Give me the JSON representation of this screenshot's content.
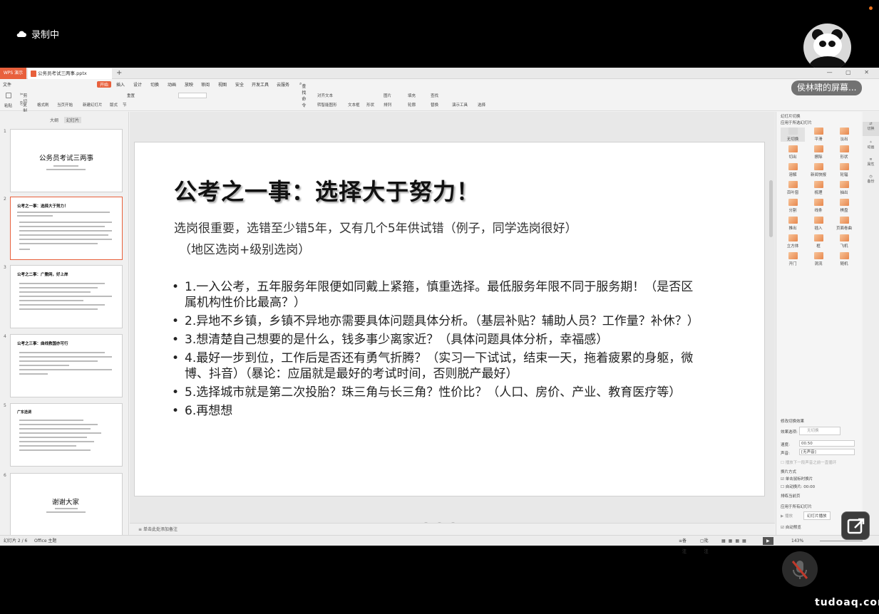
{
  "recording": {
    "label": "录制中"
  },
  "participant": {
    "name": "侯林啸的屏幕..."
  },
  "tabs": {
    "app": "WPS 演示",
    "document": "公务员考试三两事.pptx",
    "new_tab": "+"
  },
  "menu": {
    "file": "文件",
    "items": [
      "开始",
      "插入",
      "设计",
      "切换",
      "动画",
      "放映",
      "审阅",
      "视图",
      "安全",
      "开发工具",
      "云服务"
    ],
    "search": "查找命令"
  },
  "toolbar": {
    "cut": "剪切",
    "copy": "复制",
    "format_painter": "格式刷",
    "paste": "粘贴",
    "play_from": "当页开始",
    "new_slide": "新建幻灯片",
    "layout": "版式",
    "section": "节",
    "reset": "重置",
    "textbox": "文本框",
    "shape": "形状",
    "arrange": "排列",
    "picture": "图片",
    "fill": "填充",
    "outline": "轮廓",
    "find": "查找",
    "replace": "替换",
    "present_tools": "演示工具",
    "select": "选择",
    "align_text": "对齐文本",
    "smartart": "转智能图形"
  },
  "left_panel": {
    "tab_outline": "大纲",
    "tab_slides": "幻灯片",
    "thumbs": [
      {
        "num": "1",
        "title": "公务员考试三两事"
      },
      {
        "num": "2",
        "title": "公考之一事：选择大于努力！"
      },
      {
        "num": "3",
        "title": "公考之二事：广撒网，好上岸"
      },
      {
        "num": "4",
        "title": "公考之三事：曲线救国亦可行"
      },
      {
        "num": "5",
        "title": "广东选调"
      },
      {
        "num": "6",
        "title": "谢谢大家"
      }
    ]
  },
  "slide": {
    "title": "公考之一事：选择大于努力！",
    "subtitle1": "选岗很重要，选错至少错5年，又有几个5年供试错（例子，同学选岗很好）",
    "subtitle2": "（地区选岗+级别选岗）",
    "bullets": [
      "1.一入公考，五年服务年限便如同戴上紧箍，慎重选择。最低服务年限不同于服务期！（是否区属机构性价比最高？）",
      "2.异地不乡镇，乡镇不异地亦需要具体问题具体分析。（基层补贴？辅助人员？工作量？补休？）",
      "3.想清楚自己想要的是什么，钱多事少离家近？（具体问题具体分析，幸福感）",
      "4.最好一步到位，工作后是否还有勇气折腾？（实习一下试试，结束一天，拖着疲累的身躯，微博、抖音）（暴论：应届就是最好的考试时间，否则脱产最好）",
      "5.选择城市就是第二次投胎？珠三角与长三角？性价比？（人口、房价、产业、教育医疗等）",
      "6.再想想"
    ]
  },
  "notes": {
    "placeholder": "单击此处添加备注"
  },
  "right_panel": {
    "title": "幻灯片切换",
    "apply_label": "应用于所选幻灯片",
    "effects": [
      "无切换",
      "平滑",
      "淡出",
      "切出",
      "擦除",
      "形状",
      "溶解",
      "新闻快报",
      "轮辐",
      "百叶窗",
      "梳理",
      "抽出",
      "分割",
      "线条",
      "棋盘",
      "推出",
      "插入",
      "页面卷曲",
      "立方体",
      "框",
      "飞机",
      "开门",
      "涡流",
      "随机"
    ],
    "modify_label": "修改切换效果",
    "effect_option_label": "效果选项:",
    "effect_option_value": "无切换",
    "speed_label": "速度:",
    "speed_value": "00.50",
    "sound_label": "声音:",
    "sound_value": "[无声音]",
    "loop_label": "播放下一段声音之前一直循环",
    "advance_label": "换片方式",
    "on_click": "单击鼠标时换片",
    "auto_after": "自动换片:",
    "auto_time": "00:00",
    "permanent": "排练当前页",
    "apply_all": "应用于所有幻灯片",
    "play": "播放",
    "slideshow": "幻灯片播放",
    "autopreview": "自动预览"
  },
  "sidebar": [
    "切换",
    "动画",
    "属性",
    "备份"
  ],
  "status": {
    "slide": "幻灯片 2 / 6",
    "theme": "Office 主题",
    "notes": "备注",
    "comment": "批注",
    "zoom": "143%"
  },
  "watermark": "tudoaq.com"
}
